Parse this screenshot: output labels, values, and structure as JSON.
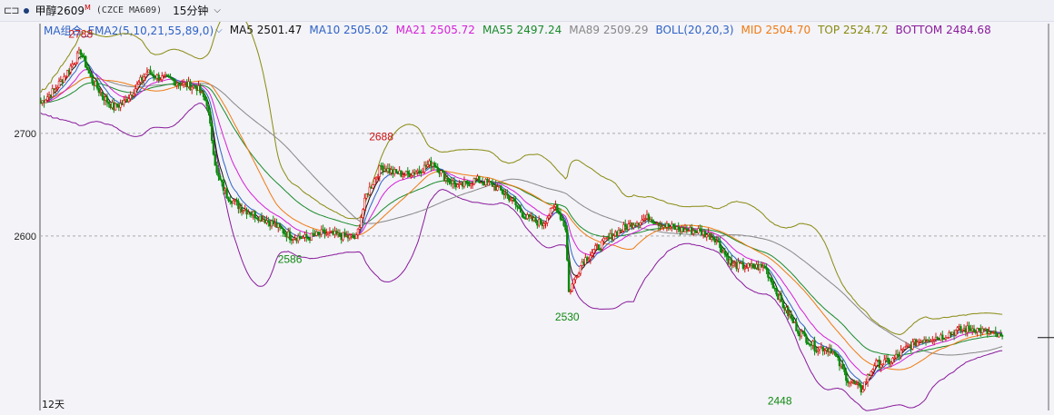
{
  "header": {
    "menu_icon": "menu-toggle-icon",
    "symbol": "甲醇2609",
    "symbol_sup": "M",
    "contract": "(CZCE MA609)",
    "period": "15分钟",
    "chevron_icon": "chevron-down-icon"
  },
  "legend": {
    "combo_label": "MA组合_EMA2(5,10,21,55,89,0)",
    "items": [
      {
        "label": "MA5 2501.47",
        "color": "#111111"
      },
      {
        "label": "MA10 2505.02",
        "color": "#2f62c5"
      },
      {
        "label": "MA21 2505.72",
        "color": "#d61fd6"
      },
      {
        "label": "MA55 2497.24",
        "color": "#1a8a2a"
      },
      {
        "label": "MA89 2509.29",
        "color": "#888888"
      },
      {
        "label": "BOLL(20,20,3)",
        "color": "#2f62c5"
      },
      {
        "label": "MID 2504.70",
        "color": "#f07a10"
      },
      {
        "label": "TOP 2524.72",
        "color": "#8a8a10"
      },
      {
        "label": "BOTTOM 2484.68",
        "color": "#8a1a9a"
      }
    ]
  },
  "footer": {
    "days_label": "12天"
  },
  "chart_data": {
    "type": "candlestick",
    "y_ticks": [
      2600,
      2700
    ],
    "ylim": [
      2430,
      2807
    ],
    "grid": true,
    "annotations": [
      {
        "text": "2788",
        "idx": 24,
        "value": 2788,
        "kind": "high",
        "color": "#cc1111"
      },
      {
        "text": "2688",
        "idx": 205,
        "value": 2688,
        "kind": "high",
        "color": "#cc1111"
      },
      {
        "text": "2586",
        "idx": 150,
        "value": 2586,
        "kind": "low",
        "color": "#118811"
      },
      {
        "text": "2530",
        "idx": 317,
        "value": 2530,
        "kind": "low",
        "color": "#118811"
      },
      {
        "text": "2448",
        "idx": 445,
        "value": 2448,
        "kind": "low",
        "color": "#118811"
      }
    ],
    "last_value": 2501,
    "path_knots": [
      [
        0,
        2730
      ],
      [
        8,
        2742
      ],
      [
        16,
        2760
      ],
      [
        22,
        2775
      ],
      [
        24,
        2780
      ],
      [
        30,
        2754
      ],
      [
        38,
        2735
      ],
      [
        44,
        2725
      ],
      [
        50,
        2730
      ],
      [
        56,
        2742
      ],
      [
        64,
        2760
      ],
      [
        70,
        2755
      ],
      [
        78,
        2752
      ],
      [
        86,
        2748
      ],
      [
        94,
        2745
      ],
      [
        100,
        2730
      ],
      [
        106,
        2660
      ],
      [
        112,
        2640
      ],
      [
        120,
        2628
      ],
      [
        130,
        2620
      ],
      [
        140,
        2612
      ],
      [
        150,
        2600
      ],
      [
        160,
        2598
      ],
      [
        170,
        2603
      ],
      [
        180,
        2600
      ],
      [
        190,
        2598
      ],
      [
        196,
        2640
      ],
      [
        205,
        2668
      ],
      [
        212,
        2662
      ],
      [
        220,
        2660
      ],
      [
        228,
        2664
      ],
      [
        236,
        2672
      ],
      [
        244,
        2656
      ],
      [
        252,
        2648
      ],
      [
        262,
        2655
      ],
      [
        272,
        2650
      ],
      [
        282,
        2638
      ],
      [
        292,
        2618
      ],
      [
        302,
        2612
      ],
      [
        310,
        2630
      ],
      [
        316,
        2608
      ],
      [
        318,
        2545
      ],
      [
        326,
        2575
      ],
      [
        336,
        2590
      ],
      [
        346,
        2603
      ],
      [
        356,
        2612
      ],
      [
        366,
        2618
      ],
      [
        376,
        2610
      ],
      [
        386,
        2606
      ],
      [
        396,
        2605
      ],
      [
        406,
        2598
      ],
      [
        416,
        2572
      ],
      [
        426,
        2570
      ],
      [
        436,
        2570
      ],
      [
        446,
        2535
      ],
      [
        456,
        2508
      ],
      [
        466,
        2492
      ],
      [
        476,
        2490
      ],
      [
        486,
        2460
      ],
      [
        494,
        2450
      ],
      [
        502,
        2475
      ],
      [
        512,
        2478
      ],
      [
        522,
        2492
      ],
      [
        532,
        2500
      ],
      [
        542,
        2502
      ],
      [
        552,
        2508
      ],
      [
        562,
        2510
      ],
      [
        572,
        2505
      ],
      [
        580,
        2500
      ]
    ],
    "n_candles": 580
  }
}
